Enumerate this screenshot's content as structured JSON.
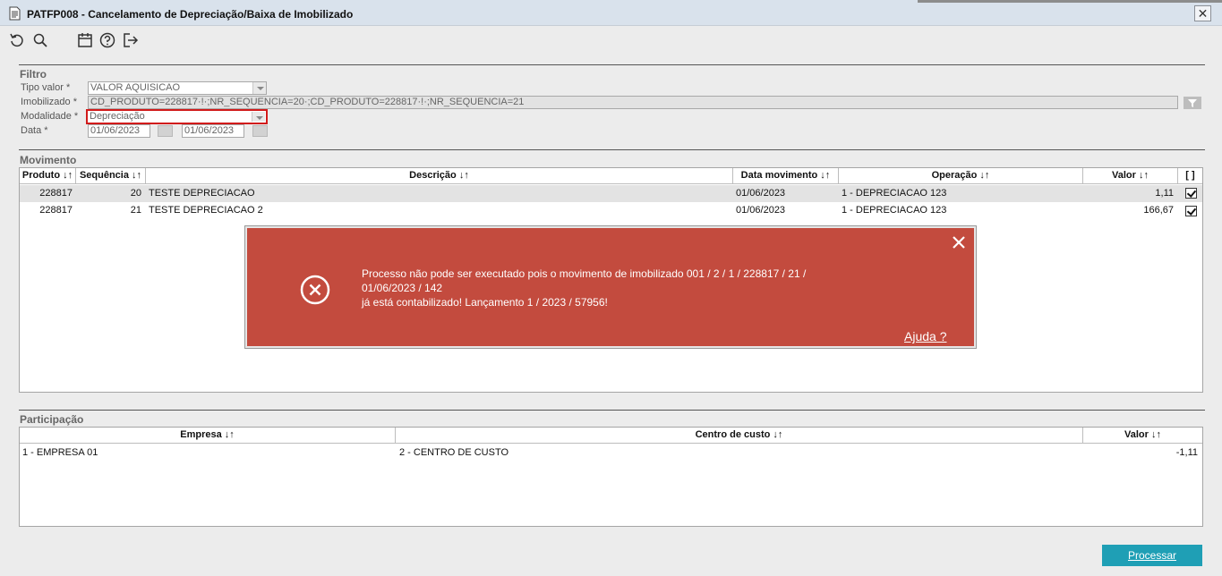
{
  "window": {
    "title": "PATFP008 - Cancelamento de Depreciação/Baixa de Imobilizado"
  },
  "filter": {
    "section_label": "Filtro",
    "tipo_valor": {
      "label": "Tipo valor *",
      "value": "VALOR AQUISICAO"
    },
    "imobilizado": {
      "label": "Imobilizado *",
      "value": "CD_PRODUTO=228817·!·;NR_SEQUENCIA=20·;CD_PRODUTO=228817·!·;NR_SEQUENCIA=21"
    },
    "modalidade": {
      "label": "Modalidade *",
      "value": "Depreciação"
    },
    "data": {
      "label": "Data *",
      "from": "01/06/2023",
      "to": "01/06/2023"
    }
  },
  "movimento": {
    "section_label": "Movimento",
    "columns": [
      "Produto ↓↑",
      "Sequência ↓↑",
      "Descrição ↓↑",
      "Data movimento ↓↑",
      "Operação ↓↑",
      "Valor ↓↑",
      "[ ]"
    ],
    "rows": [
      {
        "produto": "228817",
        "sequencia": "20",
        "descricao": "TESTE DEPRECIACAO",
        "data": "01/06/2023",
        "operacao": "1 - DEPRECIACAO 123",
        "valor": "1,11",
        "checked": true
      },
      {
        "produto": "228817",
        "sequencia": "21",
        "descricao": "TESTE DEPRECIACAO 2",
        "data": "01/06/2023",
        "operacao": "1 - DEPRECIACAO 123",
        "valor": "166,67",
        "checked": true
      }
    ]
  },
  "participacao": {
    "section_label": "Participação",
    "columns": [
      "Empresa ↓↑",
      "Centro de custo ↓↑",
      "Valor ↓↑"
    ],
    "rows": [
      {
        "empresa": "1 - EMPRESA 01",
        "centro": "2 - CENTRO DE CUSTO",
        "valor": "-1,11"
      }
    ]
  },
  "error_toast": {
    "lines": [
      "Processo não pode ser executado pois o movimento de imobilizado 001 / 2 / 1 / 228817 / 21 /",
      "01/06/2023 / 142",
      "já está contabilizado! Lançamento 1 / 2023 / 57956!"
    ],
    "help_label": "Ajuda ?",
    "color": "#c34b3e"
  },
  "actions": {
    "process_label": "Processar",
    "process_color": "#1f9fb5"
  }
}
